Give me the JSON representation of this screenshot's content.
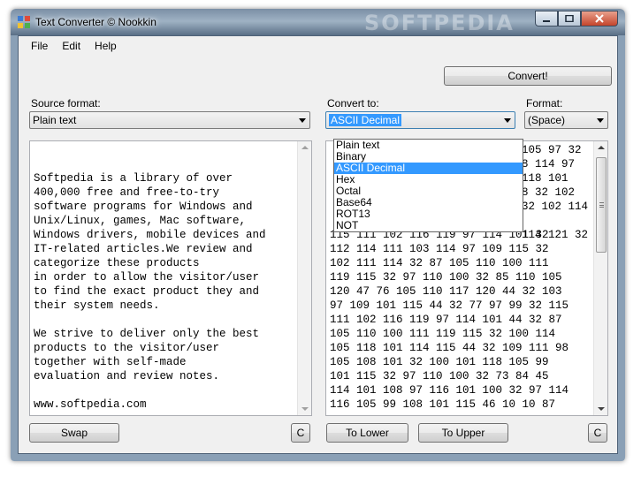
{
  "window": {
    "title": "Text Converter © Nookkin",
    "watermark": "SOFTPEDIA"
  },
  "menu": [
    "File",
    "Edit",
    "Help"
  ],
  "toolbar": {
    "convert_label": "Convert!"
  },
  "source": {
    "label": "Source format:",
    "selected": "Plain text",
    "text": "Softpedia is a library of over\n400,000 free and free-to-try\nsoftware programs for Windows and\nUnix/Linux, games, Mac software,\nWindows drivers, mobile devices and\nIT-related articles.We review and\ncategorize these products\nin order to allow the visitor/user\nto find the exact product they and\ntheir system needs.\n\nWe strive to deliver only the best\nproducts to the visitor/user\ntogether with self-made\nevaluation and review notes.\n\nwww.softpedia.com"
  },
  "convert_to": {
    "label": "Convert to:",
    "selected": "ASCII Decimal",
    "options": [
      "Plain text",
      "Binary",
      "ASCII Decimal",
      "Hex",
      "Octal",
      "Base64",
      "ROT13",
      "NOT"
    ]
  },
  "format": {
    "label": "Format:",
    "selected": "(Space)"
  },
  "output": {
    "text_right_cols": "105 97 32\n8 114 97\n118 101\n8 32 102\n32 102 114\n\n114 121 32",
    "text": "115 111 102 116 119 97 114 101 32\n112 114 111 103 114 97 109 115 32\n102 111 114 32 87 105 110 100 111\n119 115 32 97 110 100 32 85 110 105\n120 47 76 105 110 117 120 44 32 103\n97 109 101 115 44 32 77 97 99 32 115\n111 102 116 119 97 114 101 44 32 87\n105 110 100 111 119 115 32 100 114\n105 118 101 114 115 44 32 109 111 98\n105 108 101 32 100 101 118 105 99\n101 115 32 97 110 100 32 73 84 45\n114 101 108 97 116 101 100 32 97 114\n116 105 99 108 101 115 46 10 10 87"
  },
  "buttons": {
    "swap": "Swap",
    "clear_left": "C",
    "to_lower": "To Lower",
    "to_upper": "To Upper",
    "clear_right": "C"
  },
  "colors": {
    "selection": "#3399ff",
    "client_bg": "#f0f0f0"
  }
}
